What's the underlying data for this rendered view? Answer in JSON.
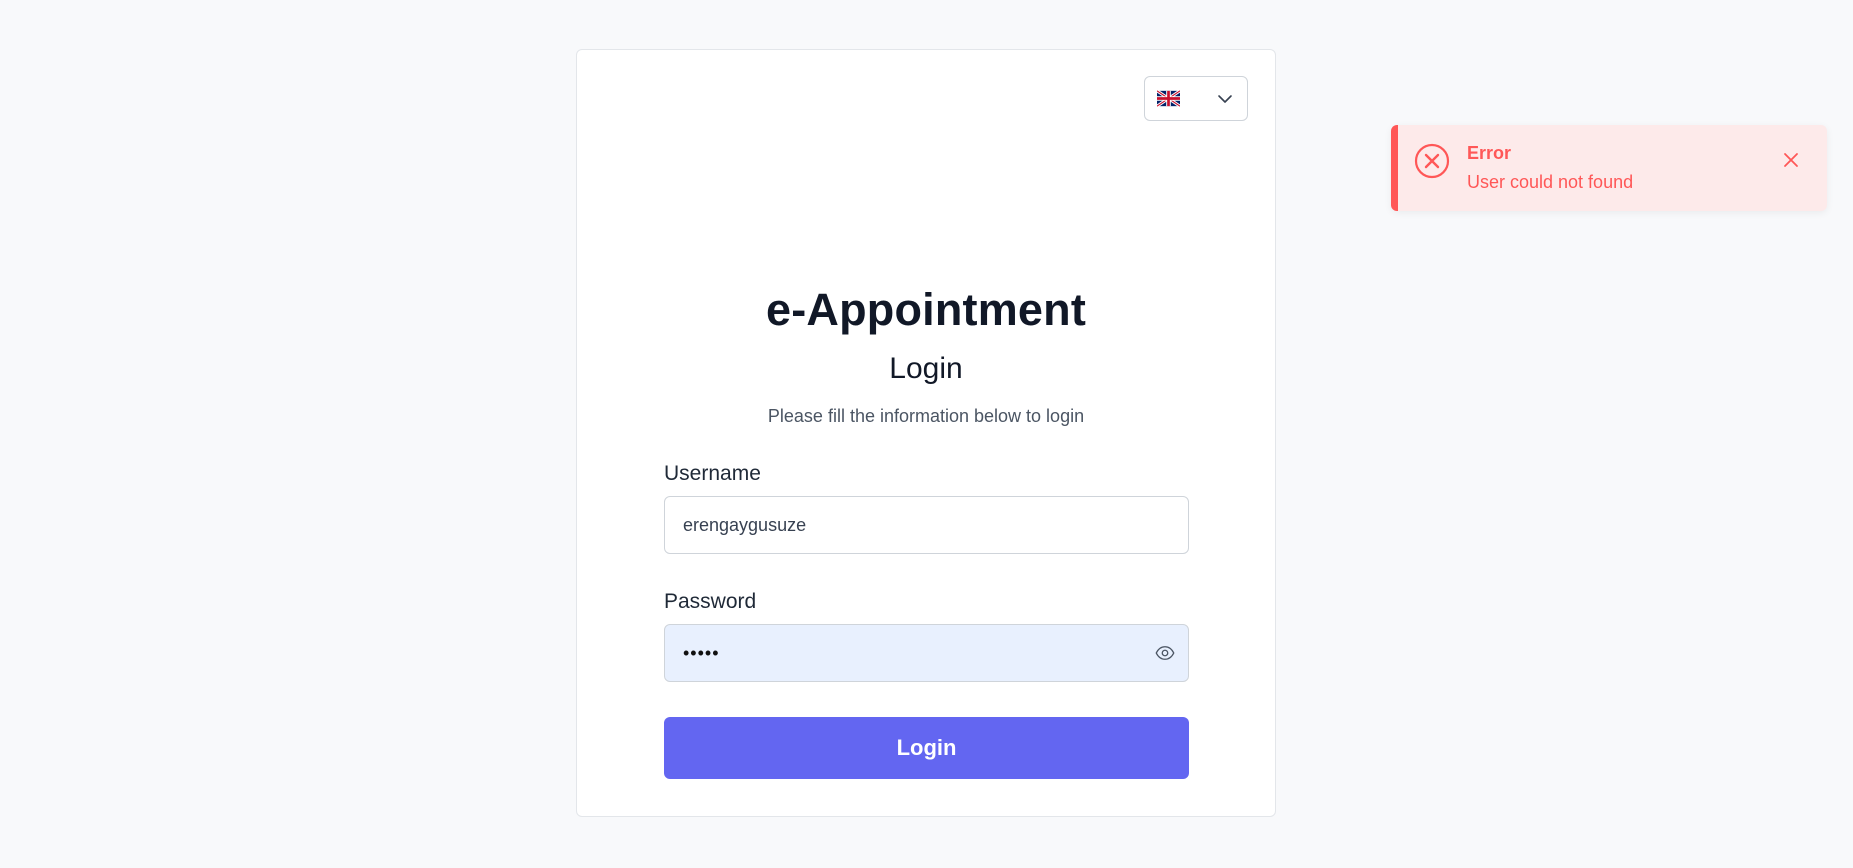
{
  "language": {
    "selected_flag": "uk-flag-icon"
  },
  "login": {
    "app_title": "e-Appointment",
    "heading": "Login",
    "subtitle": "Please fill the information below to login",
    "username_label": "Username",
    "username_value": "erengaygusuze",
    "password_label": "Password",
    "password_value": "•••••",
    "submit_label": "Login"
  },
  "toast": {
    "title": "Error",
    "message": "User could not found"
  },
  "colors": {
    "primary": "#6366f1",
    "error": "#ff5757",
    "error_bg": "#fdeaea",
    "background": "#f8f9fb"
  }
}
